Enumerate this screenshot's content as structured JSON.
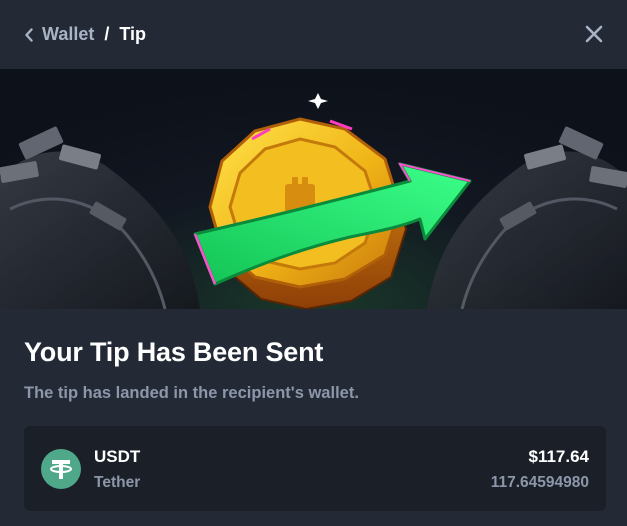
{
  "header": {
    "back_icon": "chevron-left-icon",
    "parent_label": "Wallet",
    "separator": "/",
    "current_label": "Tip",
    "close_icon": "close-icon"
  },
  "banner": {
    "illustration": "coin-with-green-arrow",
    "accent_color": "#1fe06a"
  },
  "content": {
    "title": "Your Tip Has Been Sent",
    "subtitle": "The tip has landed in the recipient's wallet."
  },
  "coin": {
    "icon": "tether-icon",
    "icon_color": "#4fa88a",
    "symbol": "USDT",
    "name": "Tether",
    "usd_value": "$117.64",
    "amount": "117.64594980"
  }
}
